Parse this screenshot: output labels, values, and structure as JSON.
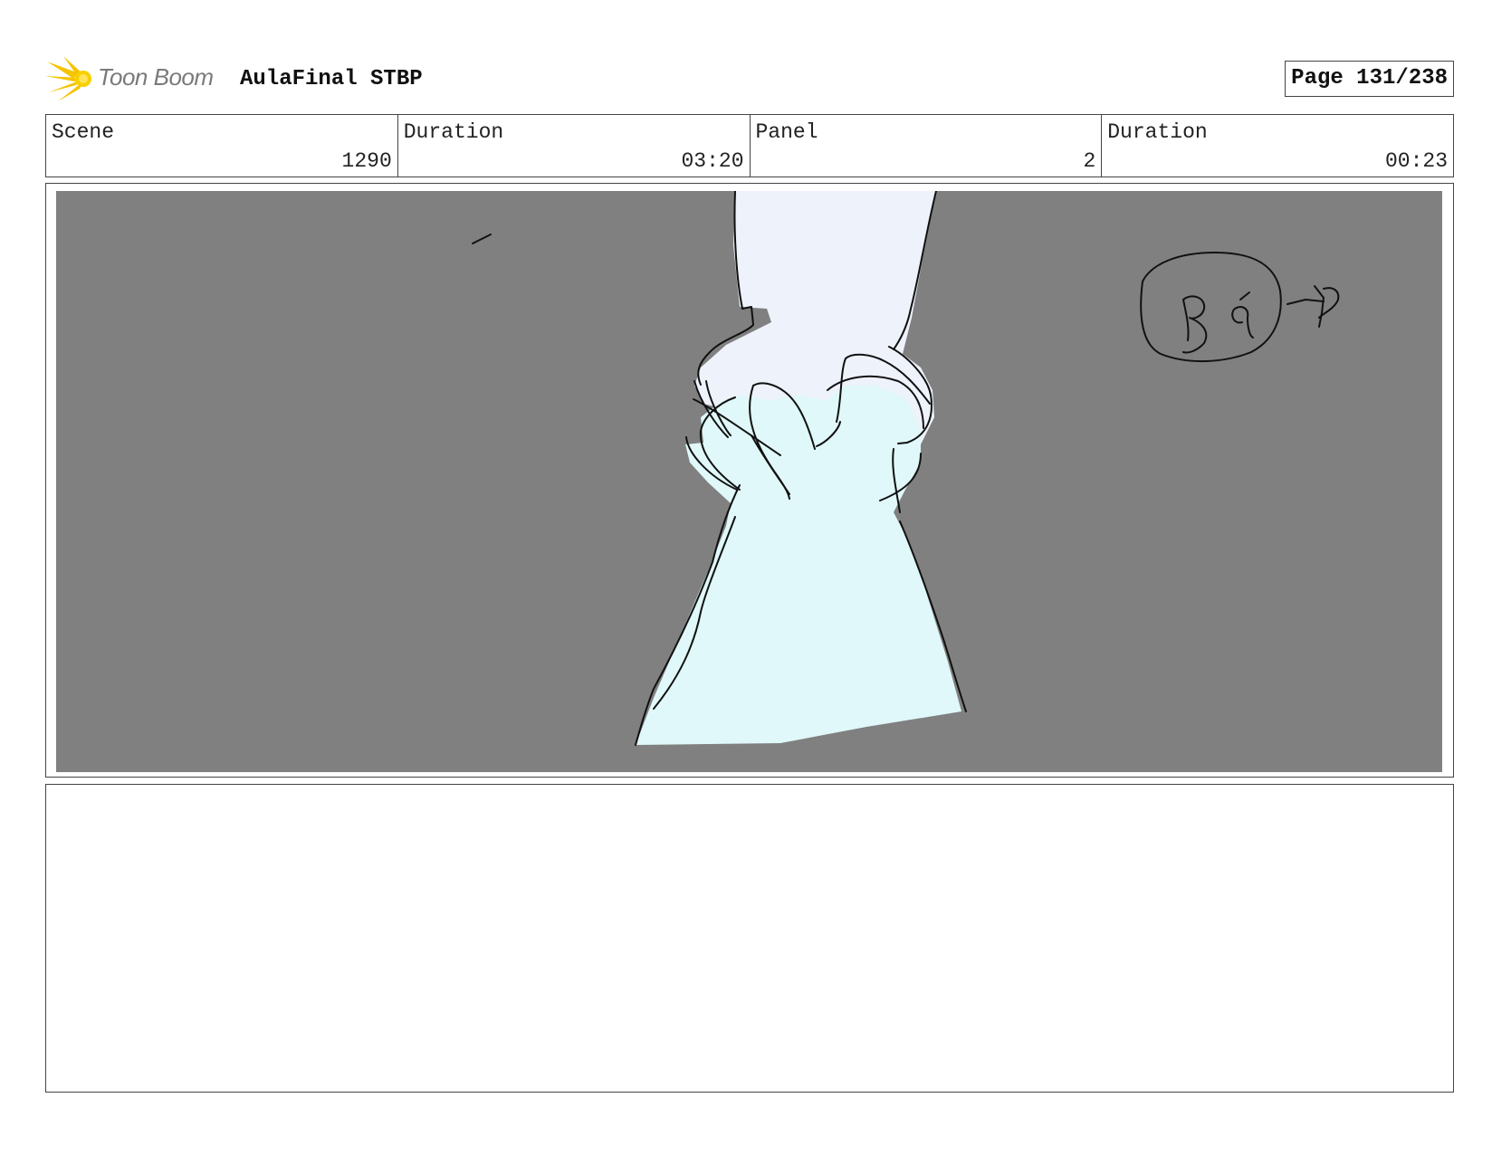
{
  "header": {
    "logo_text": "Toon Boom",
    "project_title": "AulaFinal STBP",
    "page_label": "Page 131/238"
  },
  "info": [
    {
      "label": "Scene",
      "value": "1290"
    },
    {
      "label": "Duration",
      "value": "03:20"
    },
    {
      "label": "Panel",
      "value": "2"
    },
    {
      "label": "Duration",
      "value": "00:23"
    }
  ],
  "panel": {
    "background_color": "#808080",
    "sleeve_color": "#eef2fb",
    "glove_color": "#e0f8f9",
    "annotation_text": "BG"
  },
  "notes": {
    "text": ""
  }
}
